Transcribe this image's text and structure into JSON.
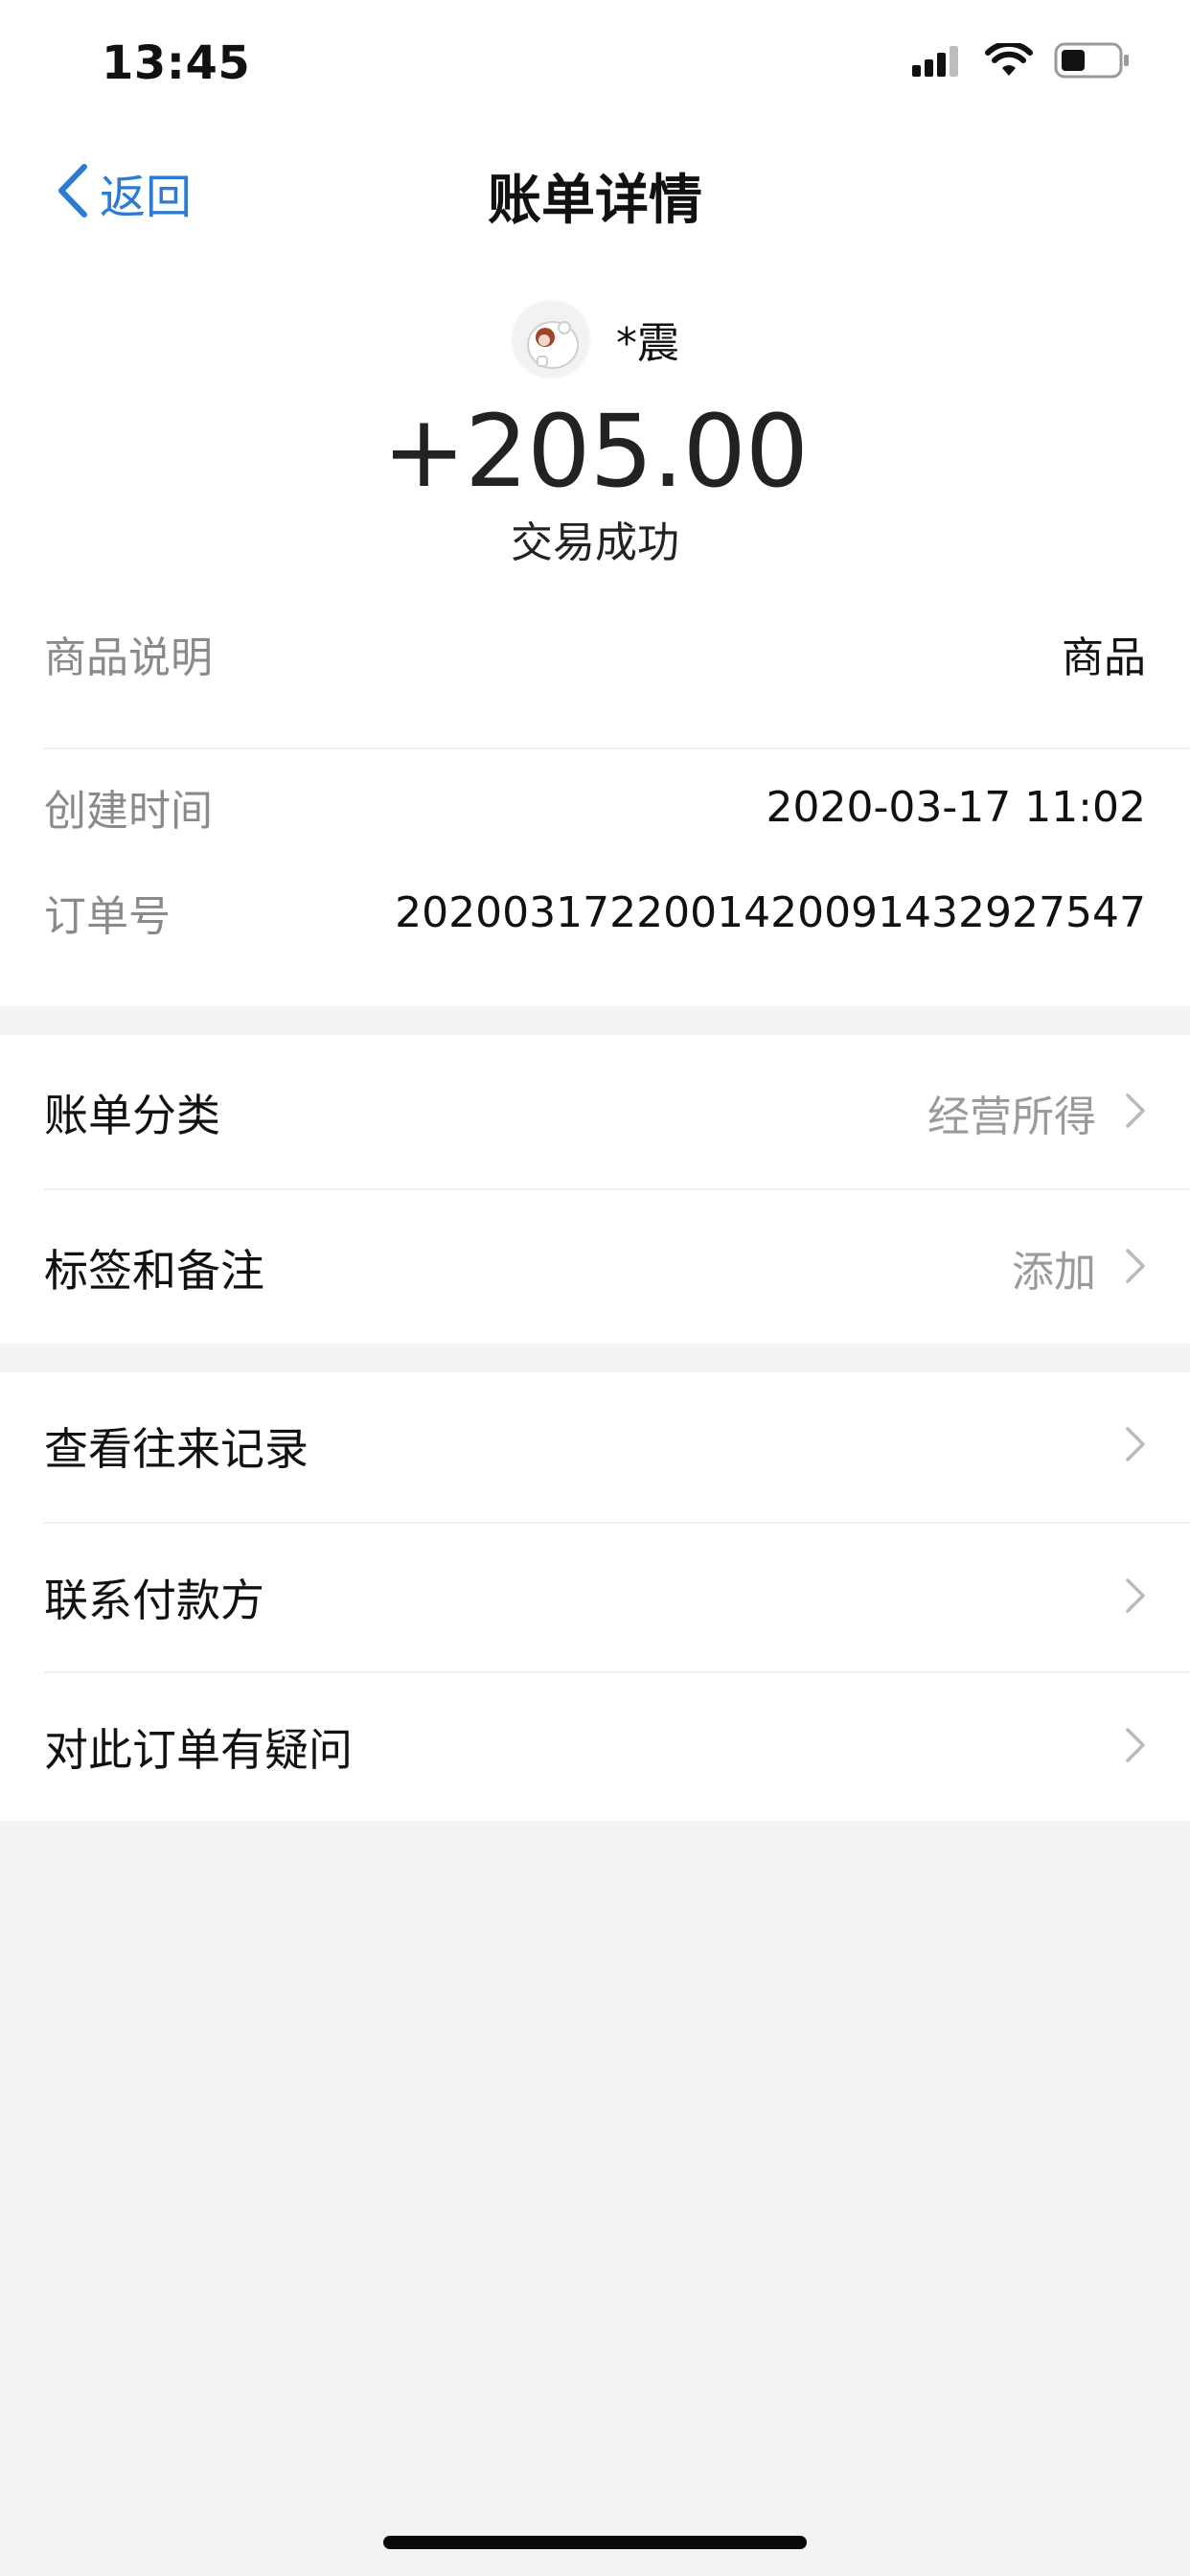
{
  "status_bar": {
    "time": "13:45"
  },
  "nav": {
    "back_label": "返回",
    "title": "账单详情"
  },
  "header": {
    "payer_name": "*震",
    "amount": "+205.00",
    "status": "交易成功"
  },
  "details": {
    "rows": [
      {
        "label": "商品说明",
        "value": "商品"
      },
      {
        "label": "创建时间",
        "value": "2020-03-17 11:02"
      },
      {
        "label": "订单号",
        "value": "2020031722001420091432927547"
      }
    ]
  },
  "section1": {
    "rows": [
      {
        "label": "账单分类",
        "value": "经营所得"
      },
      {
        "label": "标签和备注",
        "value": "添加"
      }
    ]
  },
  "section2": {
    "rows": [
      {
        "label": "查看往来记录"
      },
      {
        "label": "联系付款方"
      },
      {
        "label": "对此订单有疑问"
      }
    ]
  },
  "icons": {
    "back": "chevron-left-icon",
    "chevron": "chevron-right-icon",
    "signal": "cellular-signal-icon",
    "wifi": "wifi-icon",
    "battery": "battery-icon"
  },
  "colors": {
    "accent": "#2b7bd6",
    "background": "#f3f3f3",
    "surface": "#ffffff",
    "muted_text": "#8a8a8a"
  }
}
